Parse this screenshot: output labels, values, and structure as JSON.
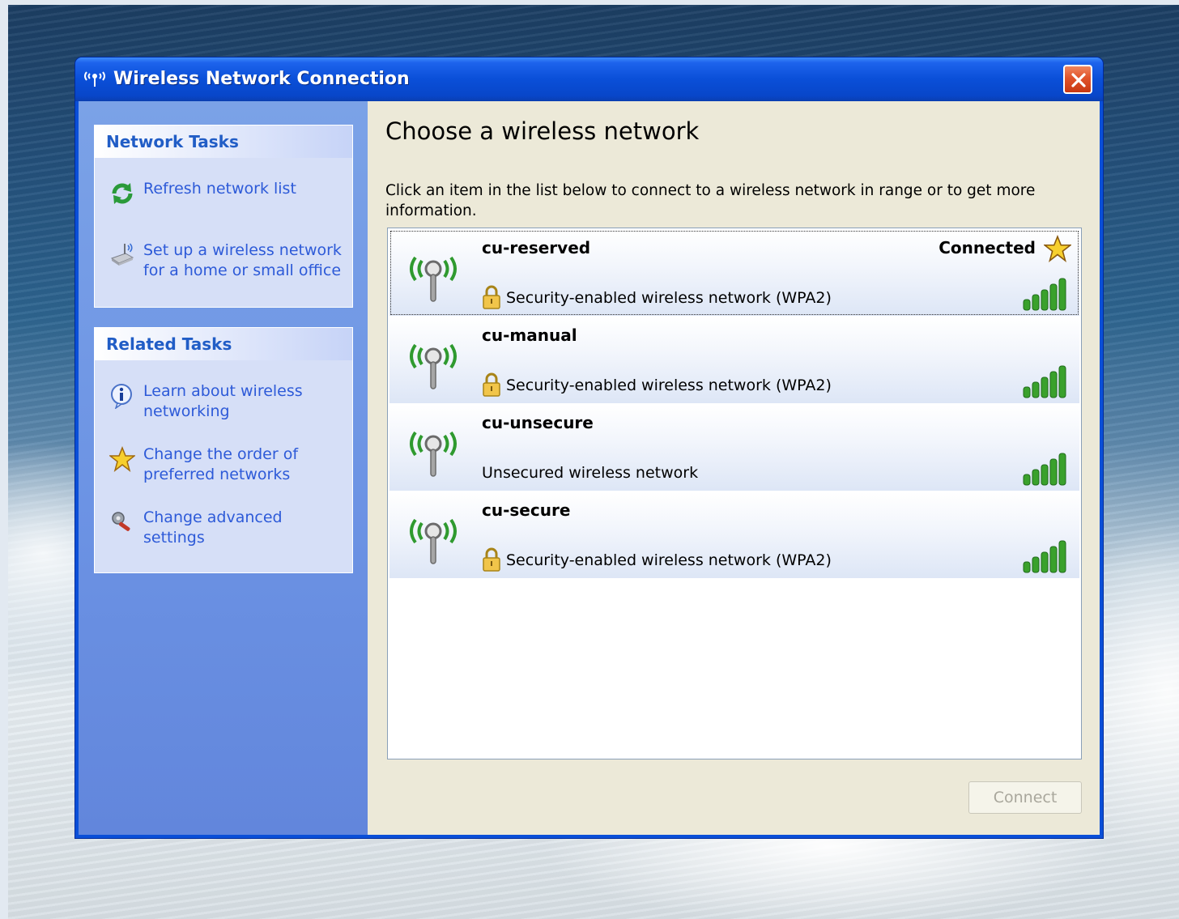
{
  "window": {
    "title": "Wireless Network Connection",
    "close_label": "×"
  },
  "network_tasks": {
    "heading": "Network Tasks",
    "items": [
      {
        "label": "Refresh network list",
        "icon": "refresh-icon"
      },
      {
        "label": "Set up a wireless network for a home or small office",
        "icon": "wireless-setup-icon"
      }
    ]
  },
  "related_tasks": {
    "heading": "Related Tasks",
    "items": [
      {
        "label": "Learn about wireless networking",
        "icon": "info-icon"
      },
      {
        "label": "Change the order of preferred networks",
        "icon": "star-icon"
      },
      {
        "label": "Change advanced settings",
        "icon": "settings-wrench-icon"
      }
    ]
  },
  "main": {
    "title": "Choose a wireless network",
    "description": "Click an item in the list below to connect to a wireless network in range or to get more information."
  },
  "networks": [
    {
      "name": "cu-reserved",
      "status": "Connected",
      "security": "Security-enabled wireless network (WPA2)",
      "secured": true,
      "signal_bars": 5,
      "selected": true
    },
    {
      "name": "cu-manual",
      "status": "",
      "security": "Security-enabled wireless network (WPA2)",
      "secured": true,
      "signal_bars": 5,
      "selected": false
    },
    {
      "name": "cu-unsecure",
      "status": "",
      "security": "Unsecured wireless network",
      "secured": false,
      "signal_bars": 5,
      "selected": false
    },
    {
      "name": "cu-secure",
      "status": "",
      "security": "Security-enabled wireless network (WPA2)",
      "secured": true,
      "signal_bars": 5,
      "selected": false
    }
  ],
  "buttons": {
    "connect": "Connect",
    "connect_enabled": false
  },
  "colors": {
    "titlebar": "#0a4fd8",
    "task_link": "#2d5ad8",
    "task_heading": "#215dc6",
    "signal_green": "#3aa12c"
  }
}
